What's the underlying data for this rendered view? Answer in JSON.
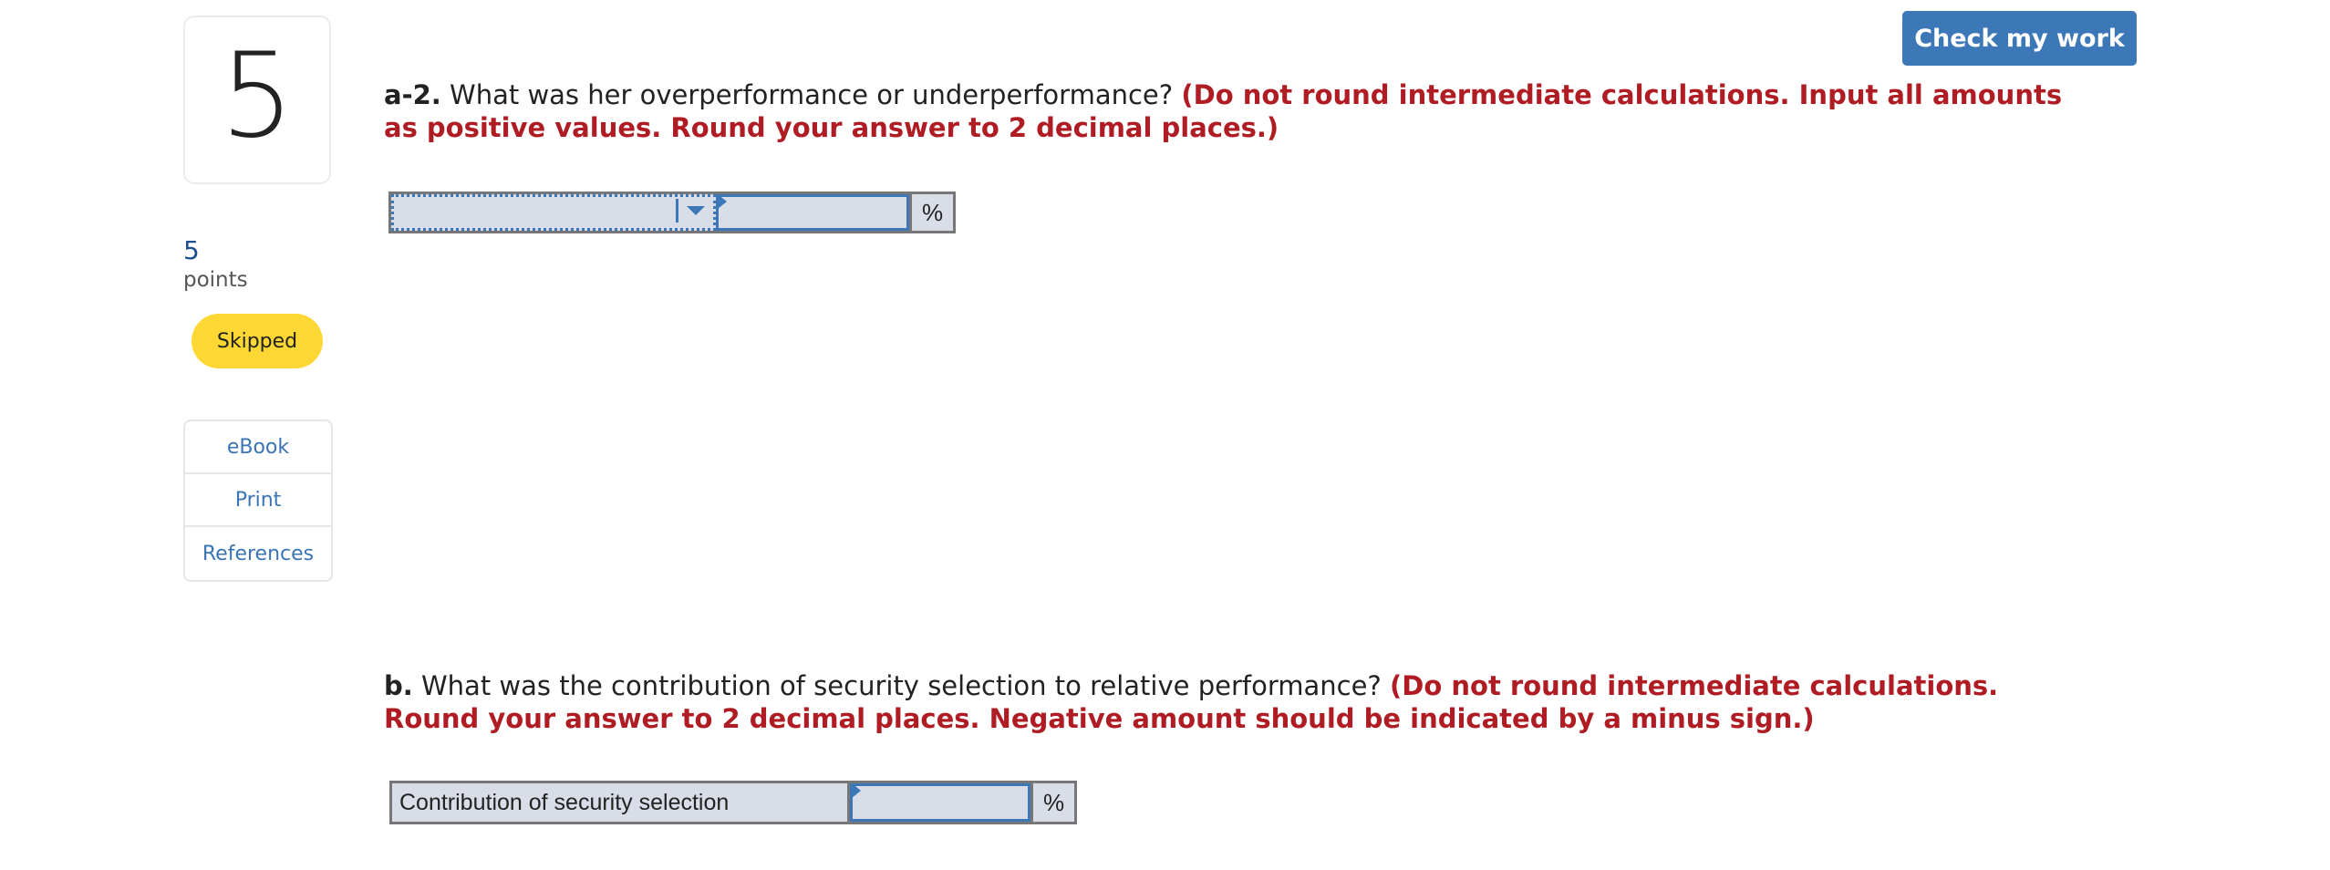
{
  "question": {
    "number": "5",
    "points_value": "5",
    "points_label": "points",
    "status": "Skipped"
  },
  "resources": [
    {
      "label": "eBook"
    },
    {
      "label": "Print"
    },
    {
      "label": "References"
    }
  ],
  "toolbar": {
    "check_label": "Check my work"
  },
  "part_a2": {
    "label": "a-2.",
    "text": " What was her overperformance or underperformance? ",
    "instruction": "(Do not round intermediate calculations. Input all amounts as positive values. Round your answer to 2 decimal places.)",
    "dropdown_selected": "",
    "input_value": "",
    "unit": "%"
  },
  "part_b": {
    "label": "b.",
    "text": " What was the contribution of security selection to relative performance? ",
    "instruction": "(Do not round intermediate calculations. Round your answer to 2 decimal places. Negative amount should be indicated by a minus sign.)",
    "row_label": "Contribution of security selection",
    "input_value": "",
    "unit": "%"
  },
  "colors": {
    "accent": "#3c77b8",
    "instruction_red": "#b01c23",
    "status_yellow": "#fdd835",
    "input_bg": "#d9dde7"
  }
}
